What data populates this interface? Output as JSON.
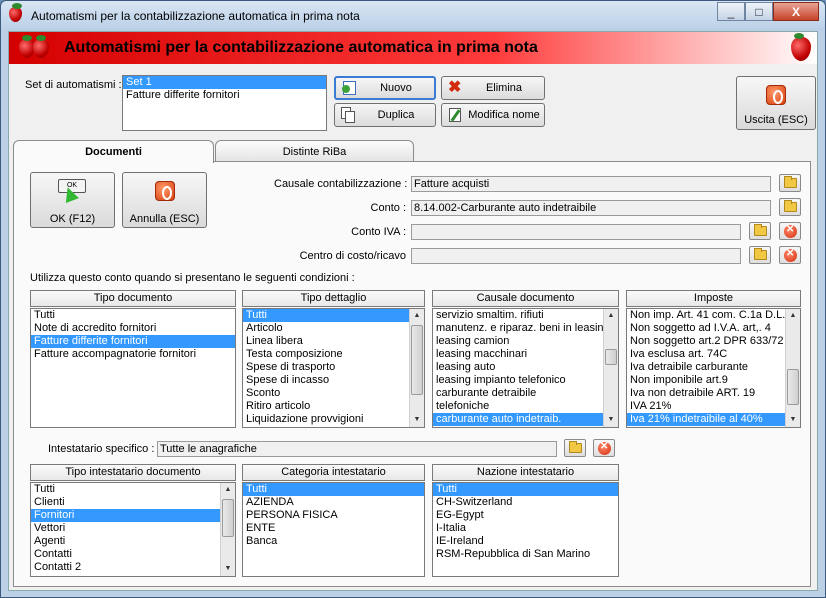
{
  "window": {
    "title": "Automatismi per la contabilizzazione automatica in prima nota",
    "controls": [
      "_",
      "□",
      "X"
    ]
  },
  "banner": {
    "title": "Automatismi per la contabilizzazione automatica in prima nota"
  },
  "set": {
    "label": "Set di automatismi :",
    "items": [
      "Set 1",
      "Fatture differite fornitori"
    ],
    "selected_index": 0
  },
  "buttons": {
    "nuovo": "Nuovo",
    "elimina": "Elimina",
    "duplica": "Duplica",
    "modifica_nome": "Modifica nome",
    "uscita": "Uscita (ESC)",
    "ok": "OK (F12)",
    "annulla": "Annulla (ESC)",
    "ok_icon_text": "OK"
  },
  "tabs": [
    "Documenti",
    "Distinte RiBa"
  ],
  "form": {
    "causale_label": "Causale contabilizzazione :",
    "causale_value": "Fatture acquisti",
    "conto_label": "Conto :",
    "conto_value": "8.14.002-Carburante auto indetraibile",
    "conto_iva_label": "Conto IVA :",
    "conto_iva_value": "",
    "centro_label": "Centro di costo/ricavo",
    "centro_value": ""
  },
  "conditions_label": "Utilizza questo conto quando si presentano le seguenti condizioni :",
  "lists": {
    "tipo_documento": {
      "header": "Tipo documento",
      "items": [
        "Tutti",
        "Note di accredito fornitori",
        "Fatture differite fornitori",
        "Fatture accompagnatorie fornitori"
      ],
      "selected_index": 2
    },
    "tipo_dettaglio": {
      "header": "Tipo dettaglio",
      "items": [
        "Tutti",
        "Articolo",
        "Linea libera",
        "Testa composizione",
        "Spese di trasporto",
        "Spese di incasso",
        "Sconto",
        "Ritiro articolo",
        "Liquidazione provvigioni"
      ],
      "selected_index": 0
    },
    "causale_documento": {
      "header": "Causale documento",
      "items": [
        "servizio smaltim. rifiuti",
        "manutenz. e riparaz. beni in leasing",
        "leasing camion",
        "leasing macchinari",
        "leasing auto",
        "leasing impianto telefonico",
        "carburante detraibile",
        "telefoniche",
        "carburante auto indetraib."
      ],
      "selected_index": 8
    },
    "imposte": {
      "header": "Imposte",
      "items": [
        "Non imp. Art. 41 com. C.1a D.L.",
        "Non soggetto ad I.V.A. art,. 4",
        "Non soggetto art.2 DPR 633/72",
        "Iva esclusa art. 74C",
        "Iva detraibile carburante",
        "Non imponibile art.9",
        "Iva non detraibile ART. 19",
        "IVA 21%",
        "Iva 21% indetraibile al 40%"
      ],
      "selected_index": 8
    },
    "tipo_intestatario": {
      "header": "Tipo intestatario documento",
      "items": [
        "Tutti",
        "Clienti",
        "Fornitori",
        "Vettori",
        "Agenti",
        "Contatti",
        "Contatti 2"
      ],
      "selected_index": 2
    },
    "categoria_intestatario": {
      "header": "Categoria intestatario",
      "items": [
        "Tutti",
        "AZIENDA",
        "PERSONA FISICA",
        "ENTE",
        "Banca"
      ],
      "selected_index": 0
    },
    "nazione_intestatario": {
      "header": "Nazione intestatario",
      "items": [
        "Tutti",
        "CH-Switzerland",
        "EG-Egypt",
        "I-Italia",
        "IE-Ireland",
        "RSM-Repubblica di San Marino"
      ],
      "selected_index": 0
    }
  },
  "intestatario": {
    "label": "Intestatario specifico :",
    "value": "Tutte le anagrafiche"
  },
  "colors": {
    "selection": "#3399ff",
    "banner_red": "#d40000"
  }
}
